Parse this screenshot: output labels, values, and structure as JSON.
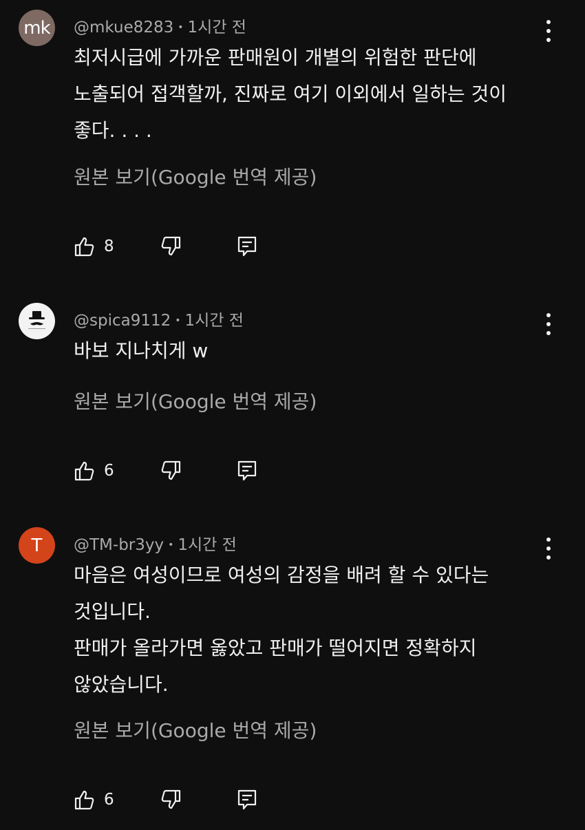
{
  "comments": [
    {
      "avatar_text": "mk",
      "avatar_color": "#7e6a62",
      "author": "@mkue8283",
      "time": "1시간 전",
      "lines": [
        "최저시급에 가까운 판매원이 개별의 위험한 판단에",
        "노출되어 접객할까, 진짜로 여기 이외에서 일하는 것이",
        "좋다. . . ."
      ],
      "translate_label": "원본 보기(Google 번역 제공)",
      "likes": "8"
    },
    {
      "avatar_text": "",
      "avatar_color": "#f3f3f3",
      "author": "@spica9112",
      "time": "1시간 전",
      "lines": [
        "바보 지나치게 w"
      ],
      "translate_label": "원본 보기(Google 번역 제공)",
      "likes": "6"
    },
    {
      "avatar_text": "T",
      "avatar_color": "#d3441a",
      "author": "@TM-br3yy",
      "time": "1시간 전",
      "lines": [
        "마음은 여성이므로 여성의 감정을 배려 할 수 있다는",
        "것입니다.",
        "판매가 올라가면 옳았고 판매가 떨어지면 정확하지",
        "않았습니다."
      ],
      "translate_label": "원본 보기(Google 번역 제공)",
      "likes": "6"
    }
  ],
  "meta_separator": "•",
  "icons": {
    "like": "thumbs-up-icon",
    "dislike": "thumbs-down-icon",
    "reply": "reply-icon",
    "menu": "more-vertical-icon"
  }
}
